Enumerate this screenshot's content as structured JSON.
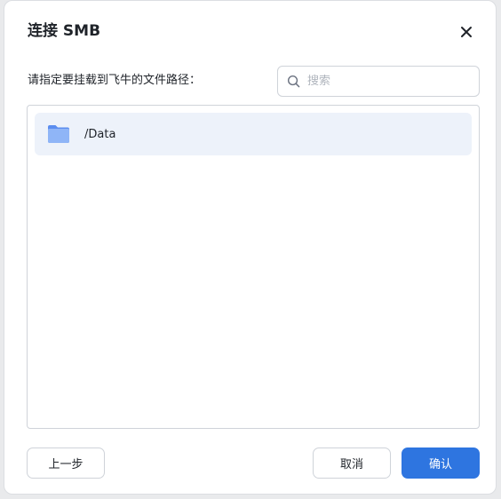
{
  "dialog": {
    "title": "连接 SMB",
    "close_icon": "close-icon"
  },
  "prompt": {
    "text": "请指定要挂载到飞牛的文件路径："
  },
  "search": {
    "placeholder": "搜索",
    "value": "",
    "icon": "search-icon"
  },
  "file_list": {
    "items": [
      {
        "label": "/Data",
        "icon": "folder-icon",
        "selected": true
      }
    ]
  },
  "footer": {
    "prev_label": "上一步",
    "cancel_label": "取消",
    "confirm_label": "确认"
  },
  "colors": {
    "primary": "#2e75e0",
    "selected_row": "#edf2fa",
    "folder": "#7aa8f5",
    "border": "#cfd3d9"
  }
}
